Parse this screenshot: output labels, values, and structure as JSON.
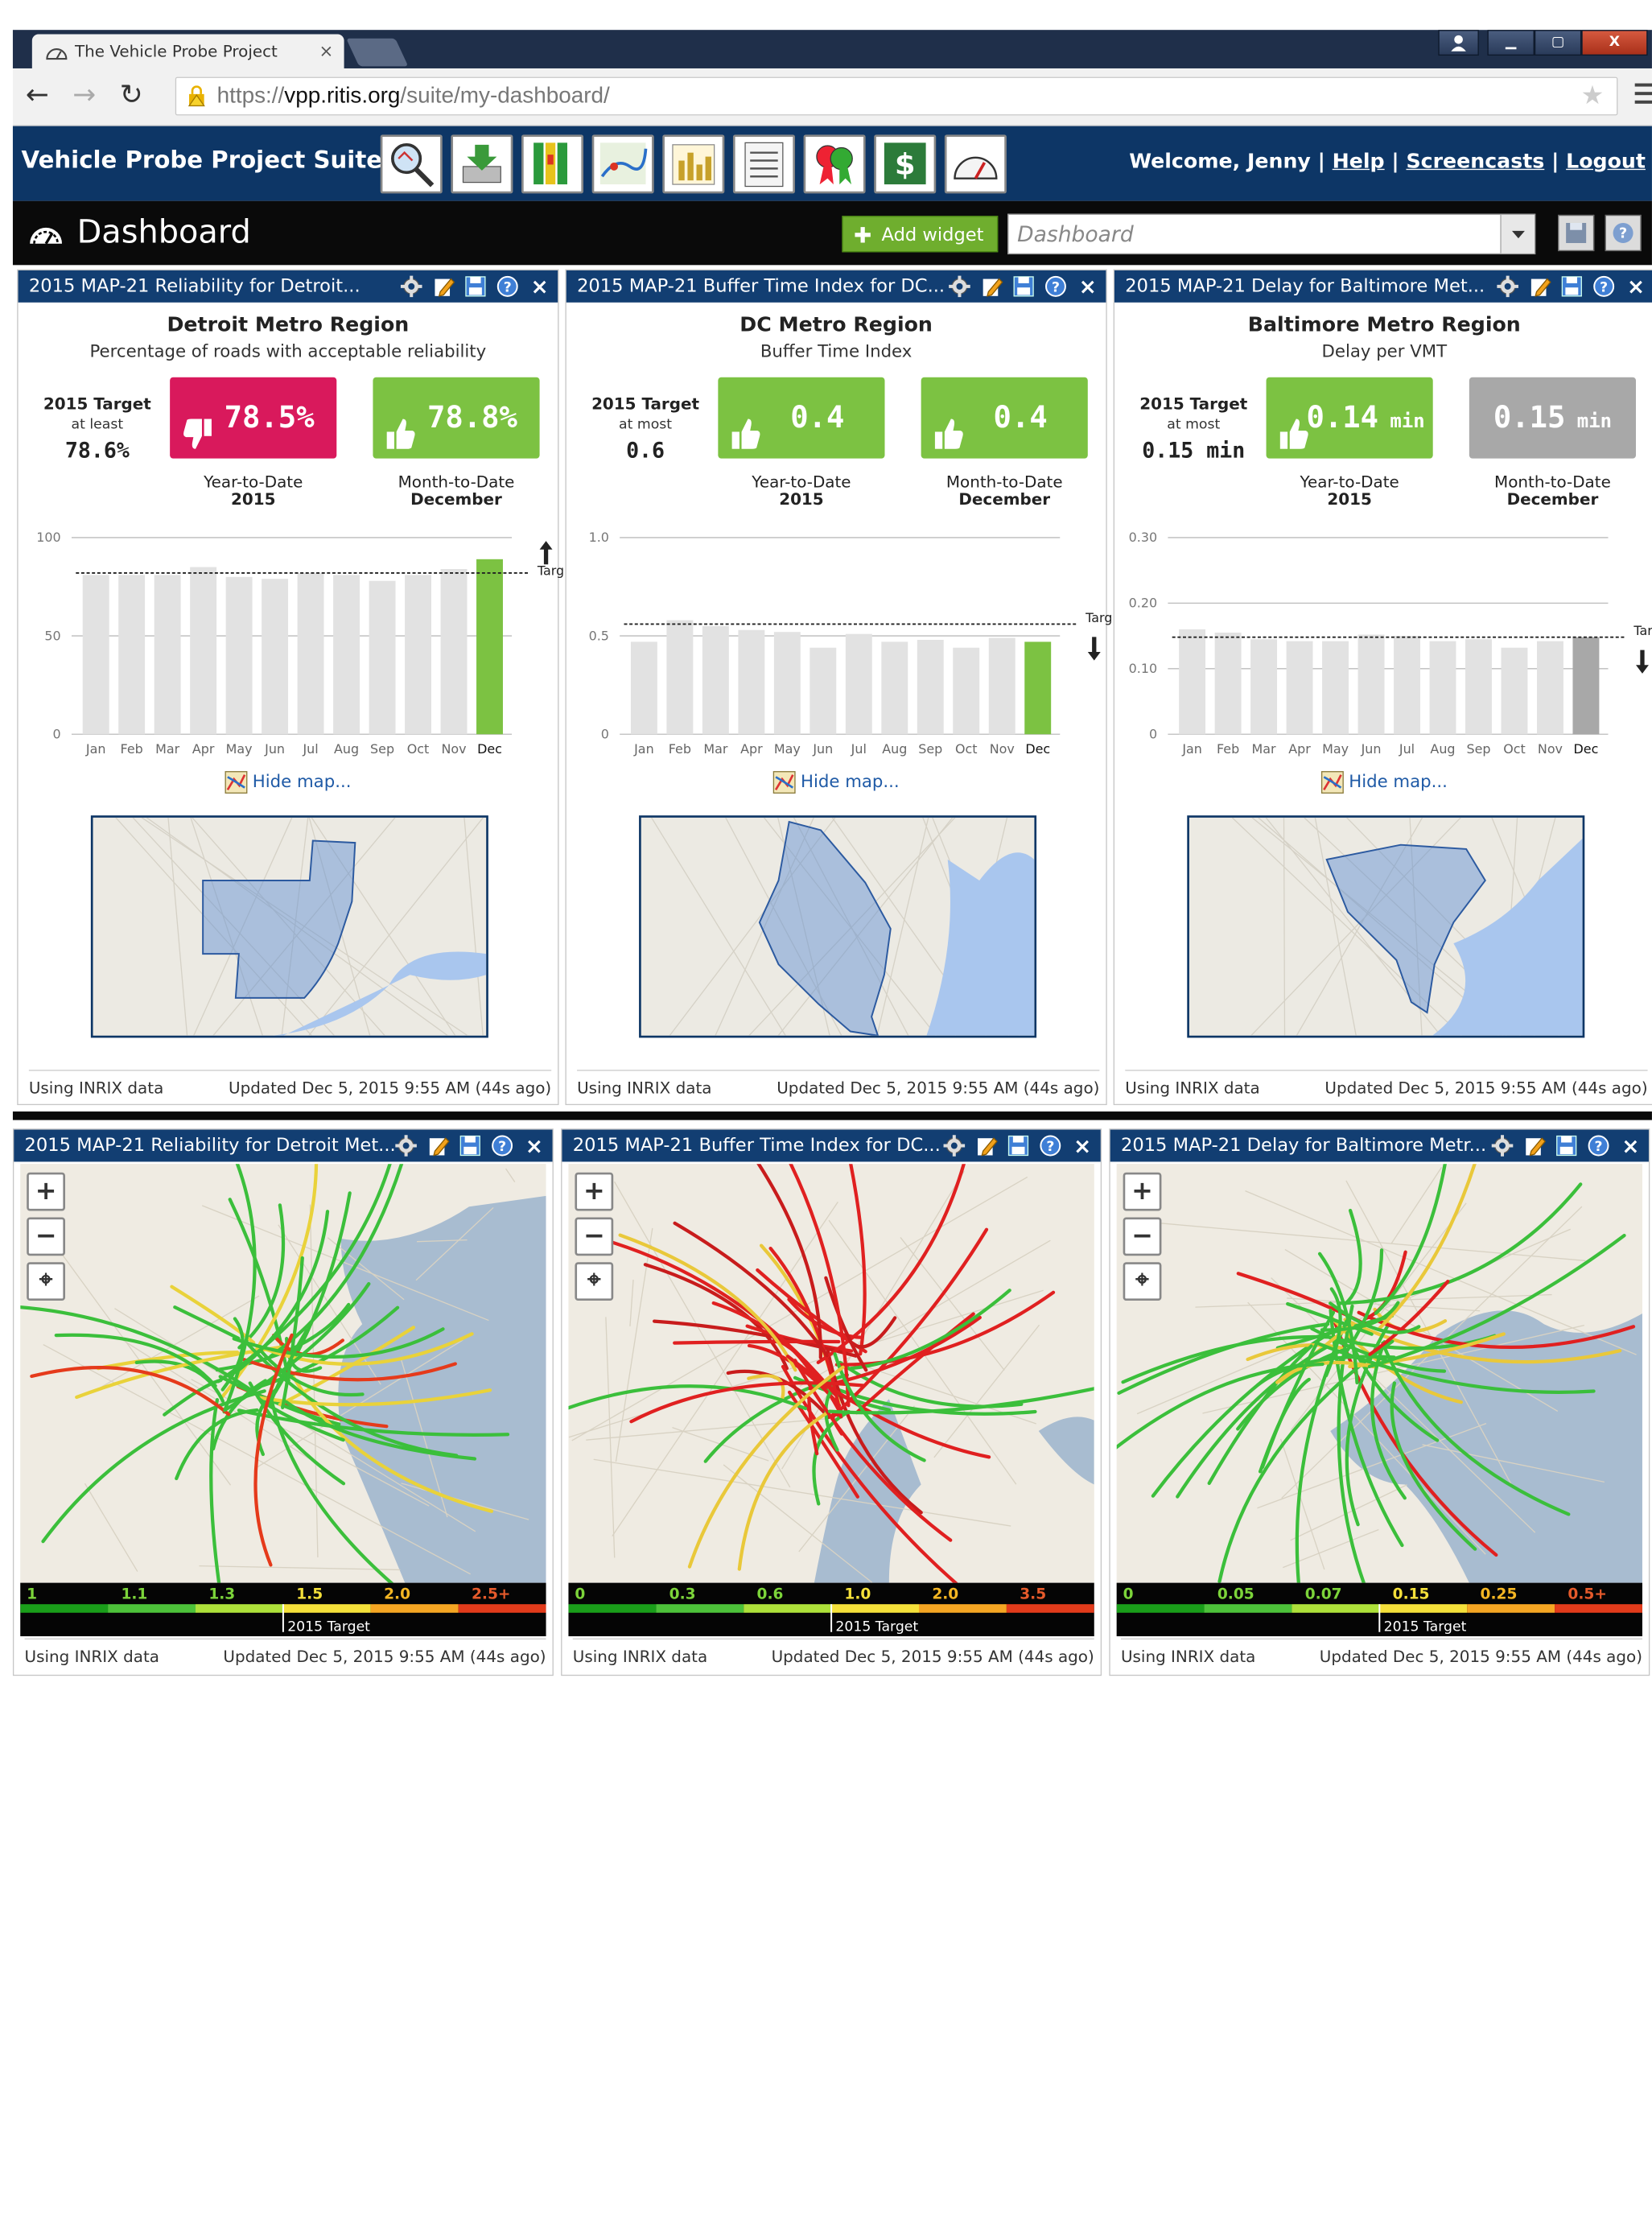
{
  "browser": {
    "tab_title": "The Vehicle Probe Project",
    "tab_close": "×",
    "url_scheme": "https://",
    "url_host": "vpp.ritis.org",
    "url_path": "/suite/my-dashboard/",
    "min": "▁",
    "max": "▢",
    "close": "X"
  },
  "header": {
    "suite": "Vehicle Probe Project Suite",
    "welcome": "Welcome, Jenny",
    "sep": "|",
    "help": "Help",
    "screencasts": "Screencasts",
    "logout": "Logout"
  },
  "dash": {
    "title": "Dashboard",
    "add_widget": "Add widget",
    "add_plus": "✚",
    "select_placeholder": "Dashboard"
  },
  "common": {
    "using": "Using INRIX data",
    "updated": "Updated Dec 5, 2015 9:55 AM (44s ago)",
    "hide_map": "Hide map...",
    "target": "Target",
    "ytd": "Year-to-Date",
    "ytd_sub": "2015",
    "mtd": "Month-to-Date",
    "mtd_sub": "December",
    "zoom_in": "+",
    "zoom_out": "−",
    "locate": "⌖",
    "legend_target": "2015 Target",
    "close": "×"
  },
  "widgets": [
    {
      "title": "2015 MAP-21 Reliability for Detroit...",
      "region": "Detroit Metro Region",
      "subtitle": "Percentage of roads with acceptable reliability",
      "tgt1": "2015 Target",
      "tgt2": "at least",
      "tgt3": "78.6%",
      "ytd_value": "78.5%",
      "ytd_color": "#d9195c",
      "mtd_value": "78.8%",
      "mtd_color": "#7cc242",
      "mtd_unit": ""
    },
    {
      "title": "2015 MAP-21 Buffer Time Index for DC...",
      "region": "DC Metro Region",
      "subtitle": "Buffer Time Index",
      "tgt1": "2015 Target",
      "tgt2": "at most",
      "tgt3": "0.6",
      "ytd_value": "0.4",
      "ytd_color": "#7cc242",
      "mtd_value": "0.4",
      "mtd_color": "#7cc242",
      "mtd_unit": ""
    },
    {
      "title": "2015 MAP-21 Delay for Baltimore Met...",
      "region": "Baltimore Metro Region",
      "subtitle": "Delay per VMT",
      "tgt1": "2015 Target",
      "tgt2": "at most",
      "tgt3": "0.15 min",
      "ytd_value": "0.14",
      "ytd_unit": "min",
      "ytd_color": "#7cc242",
      "mtd_value": "0.15",
      "mtd_unit": "min",
      "mtd_color": "#a8a8a8"
    }
  ],
  "maps": [
    {
      "title": "2015 MAP-21 Reliability for Detroit Met...",
      "legend": [
        "1",
        "1.1",
        "1.3",
        "1.5",
        "2.0",
        "2.5+"
      ]
    },
    {
      "title": "2015 MAP-21 Buffer Time Index for DC...",
      "legend": [
        "0",
        "0.3",
        "0.6",
        "1.0",
        "2.0",
        "3.5"
      ]
    },
    {
      "title": "2015 MAP-21 Delay for Baltimore Metr...",
      "legend": [
        "0",
        "0.05",
        "0.07",
        "0.15",
        "0.25",
        "0.5+"
      ]
    }
  ],
  "chart_data": [
    {
      "type": "bar",
      "categories": [
        "Jan",
        "Feb",
        "Mar",
        "Apr",
        "May",
        "Jun",
        "Jul",
        "Aug",
        "Sep",
        "Oct",
        "Nov",
        "Dec"
      ],
      "values": [
        81,
        81,
        81,
        85,
        80,
        79,
        82,
        81,
        78,
        81,
        84,
        89
      ],
      "highlight_color": "#7cc242",
      "target": 82,
      "target_direction": "up",
      "yticks": [
        0,
        50,
        100
      ],
      "ylim": [
        0,
        100
      ]
    },
    {
      "type": "bar",
      "categories": [
        "Jan",
        "Feb",
        "Mar",
        "Apr",
        "May",
        "Jun",
        "Jul",
        "Aug",
        "Sep",
        "Oct",
        "Nov",
        "Dec"
      ],
      "values": [
        0.47,
        0.58,
        0.55,
        0.53,
        0.52,
        0.44,
        0.51,
        0.47,
        0.48,
        0.44,
        0.49,
        0.47
      ],
      "highlight_color": "#7cc242",
      "target": 0.56,
      "target_direction": "down",
      "yticks": [
        0,
        0.5,
        1.0
      ],
      "ytick_labels": [
        "0",
        "0.5",
        "1.0"
      ],
      "ylim": [
        0,
        1.0
      ]
    },
    {
      "type": "bar",
      "categories": [
        "Jan",
        "Feb",
        "Mar",
        "Apr",
        "May",
        "Jun",
        "Jul",
        "Aug",
        "Sep",
        "Oct",
        "Nov",
        "Dec"
      ],
      "values": [
        0.16,
        0.155,
        0.145,
        0.142,
        0.142,
        0.152,
        0.15,
        0.142,
        0.145,
        0.132,
        0.142,
        0.148
      ],
      "highlight_color": "#a8a8a8",
      "target": 0.148,
      "target_direction": "down",
      "yticks": [
        0,
        0.1,
        0.2,
        0.3
      ],
      "ytick_labels": [
        "0",
        "0.10",
        "0.20",
        "0.30"
      ],
      "ylim": [
        0,
        0.3
      ]
    }
  ]
}
